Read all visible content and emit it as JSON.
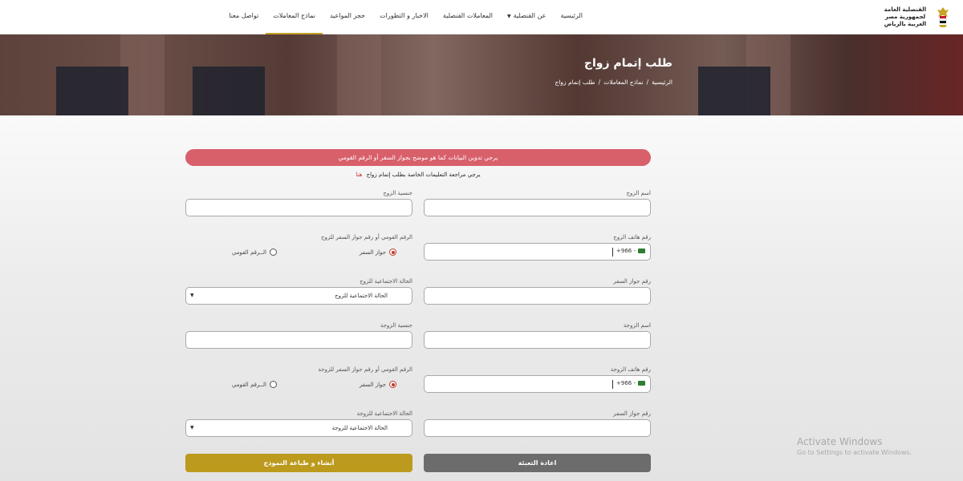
{
  "nav": {
    "logo_text": "القنصلية العامة لجمهورية مصر العربية بالرياض",
    "items": [
      {
        "label": "الرئيسية"
      },
      {
        "label": "عن القنصلية"
      },
      {
        "label": "المعاملات القنصلية"
      },
      {
        "label": "الاخبار و التطورات"
      },
      {
        "label": "حجز المواعيد"
      },
      {
        "label": "نماذج المعاملات"
      },
      {
        "label": "تواصل معنا"
      }
    ]
  },
  "hero": {
    "title": "طلب إتمام زواج",
    "breadcrumb": [
      "الرئيسية",
      "نماذج المعاملات",
      "طلب إتمام زواج"
    ],
    "separator": "/"
  },
  "alert": "يرجي تدوين البيانات كما هو موضح بجواز السفر أو الرقم القومي",
  "instruction": {
    "text": "يرجي مراجعة التعليمات الخاصة بطلب إتمام زواج",
    "link": "هنا"
  },
  "husband": {
    "name_label": "اسم الزوج",
    "nationality_label": "جنسية الزوج",
    "phone_label": "رقم هاتف الزوج",
    "phone_code": "+966 -",
    "id_type_label": "الرقم القومي أو رقم جواز السفر للزوج",
    "id_options": [
      "جواز السفر",
      "الــرقم القومي"
    ],
    "passport_label": "رقم جواز السفر",
    "marital_label": "الحالة الاجتماعية للزوج",
    "marital_select": "الحالة الاجتماعية للزوج"
  },
  "wife": {
    "name_label": "اسم الزوجة",
    "nationality_label": "جنسية الزوجة",
    "phone_label": "رقم هاتف الزوجة",
    "phone_code": "+966 -",
    "id_type_label": "الرقم القومي أو رقم جواز السفر للزوجة",
    "id_options": [
      "جواز السفر",
      "الــرقم القومي"
    ],
    "passport_label": "رقم جواز السفر",
    "marital_label": "الحالة الاجتماعية للزوجة",
    "marital_select": "الحالة الاجتماعية للزوجة"
  },
  "buttons": {
    "reset": "اعادة التعبئة",
    "submit": "أنشاء و طباعة النموذج"
  },
  "watermark": {
    "title": "Activate Windows",
    "subtitle": "Go to Settings to activate Windows."
  },
  "colors": {
    "gold": "#bc9a1e",
    "alert": "#d8606b",
    "reset": "#6c6c6c"
  }
}
